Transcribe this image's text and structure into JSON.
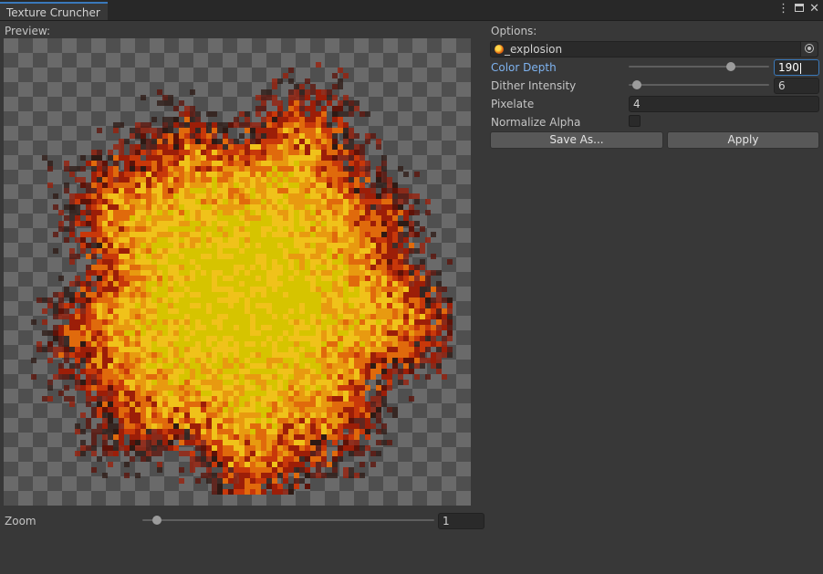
{
  "window": {
    "tab_title": "Texture Cruncher",
    "menu_icon": "kebab-menu-icon",
    "maximize_icon": "maximize-icon",
    "close_icon": "close-icon"
  },
  "preview": {
    "label": "Preview:",
    "image_subject": "pixelated-explosion-sprite"
  },
  "zoom": {
    "label": "Zoom",
    "value": "1",
    "slider_fraction": 0.05
  },
  "options": {
    "label": "Options:",
    "texture_field": {
      "value": "_explosion",
      "icon": "texture-icon",
      "picker_icon": "object-picker-icon"
    },
    "color_depth": {
      "label": "Color Depth",
      "value": "190",
      "slider_fraction": 0.73,
      "focused": true
    },
    "dither_intensity": {
      "label": "Dither Intensity",
      "value": "6",
      "slider_fraction": 0.06
    },
    "pixelate": {
      "label": "Pixelate",
      "value": "4"
    },
    "normalize_alpha": {
      "label": "Normalize Alpha",
      "checked": false
    },
    "save_as_button": "Save As...",
    "apply_button": "Apply"
  },
  "colors": {
    "accent": "#3a79bb",
    "focused_label": "#7eb3f0",
    "panel_background": "#383838"
  }
}
